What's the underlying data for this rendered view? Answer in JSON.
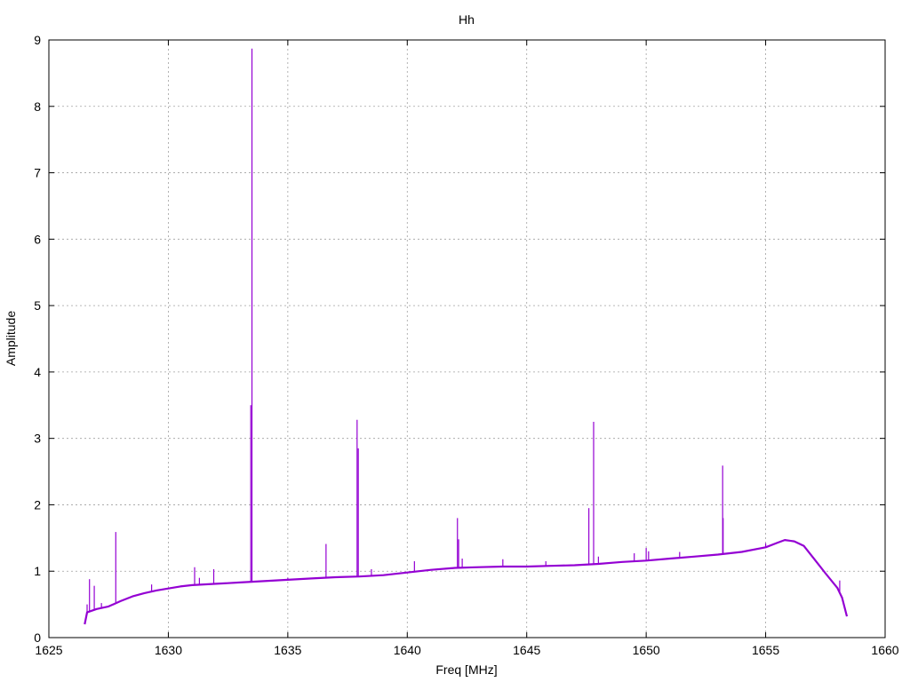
{
  "chart_data": {
    "type": "line",
    "title": "Hh",
    "xlabel": "Freq [MHz]",
    "ylabel": "Amplitude",
    "xlim": [
      1625,
      1660
    ],
    "ylim": [
      0,
      9
    ],
    "x_ticks": [
      1625,
      1630,
      1635,
      1640,
      1645,
      1650,
      1655,
      1660
    ],
    "y_ticks": [
      0,
      1,
      2,
      3,
      4,
      5,
      6,
      7,
      8,
      9
    ],
    "grid": true,
    "legend": "none",
    "series": [
      {
        "color": "#9400d3",
        "baseline": [
          [
            1626.5,
            0.2
          ],
          [
            1626.6,
            0.38
          ],
          [
            1627.0,
            0.43
          ],
          [
            1627.5,
            0.47
          ],
          [
            1628.0,
            0.55
          ],
          [
            1628.5,
            0.62
          ],
          [
            1629.0,
            0.67
          ],
          [
            1629.5,
            0.71
          ],
          [
            1630.0,
            0.74
          ],
          [
            1630.5,
            0.77
          ],
          [
            1631.0,
            0.79
          ],
          [
            1632.0,
            0.81
          ],
          [
            1633.0,
            0.83
          ],
          [
            1634.0,
            0.85
          ],
          [
            1635.0,
            0.87
          ],
          [
            1636.0,
            0.89
          ],
          [
            1637.0,
            0.91
          ],
          [
            1638.0,
            0.92
          ],
          [
            1639.0,
            0.94
          ],
          [
            1640.0,
            0.98
          ],
          [
            1640.5,
            1.0
          ],
          [
            1641.0,
            1.02
          ],
          [
            1642.0,
            1.05
          ],
          [
            1643.0,
            1.06
          ],
          [
            1644.0,
            1.07
          ],
          [
            1645.0,
            1.07
          ],
          [
            1646.0,
            1.08
          ],
          [
            1647.0,
            1.09
          ],
          [
            1648.0,
            1.11
          ],
          [
            1649.0,
            1.14
          ],
          [
            1650.0,
            1.16
          ],
          [
            1651.0,
            1.19
          ],
          [
            1652.0,
            1.22
          ],
          [
            1653.0,
            1.25
          ],
          [
            1654.0,
            1.29
          ],
          [
            1655.0,
            1.36
          ],
          [
            1655.5,
            1.43
          ],
          [
            1655.8,
            1.47
          ],
          [
            1656.2,
            1.45
          ],
          [
            1656.6,
            1.38
          ],
          [
            1657.0,
            1.2
          ],
          [
            1657.5,
            0.97
          ],
          [
            1658.0,
            0.75
          ],
          [
            1658.2,
            0.6
          ],
          [
            1658.4,
            0.32
          ]
        ],
        "peaks": [
          [
            1626.6,
            0.5
          ],
          [
            1626.7,
            0.88
          ],
          [
            1626.9,
            0.78
          ],
          [
            1627.2,
            0.52
          ],
          [
            1627.8,
            1.59
          ],
          [
            1629.3,
            0.8
          ],
          [
            1631.1,
            1.06
          ],
          [
            1631.3,
            0.9
          ],
          [
            1631.9,
            1.03
          ],
          [
            1633.45,
            3.5
          ],
          [
            1633.5,
            8.87
          ],
          [
            1635.0,
            0.9
          ],
          [
            1636.6,
            1.41
          ],
          [
            1637.9,
            3.28
          ],
          [
            1637.95,
            2.85
          ],
          [
            1638.5,
            1.03
          ],
          [
            1640.3,
            1.15
          ],
          [
            1642.1,
            1.8
          ],
          [
            1642.15,
            1.48
          ],
          [
            1642.3,
            1.19
          ],
          [
            1644.0,
            1.18
          ],
          [
            1645.8,
            1.15
          ],
          [
            1647.6,
            1.95
          ],
          [
            1647.8,
            3.25
          ],
          [
            1648.0,
            1.22
          ],
          [
            1649.5,
            1.27
          ],
          [
            1650.0,
            1.35
          ],
          [
            1650.1,
            1.3
          ],
          [
            1651.4,
            1.29
          ],
          [
            1653.2,
            2.59
          ],
          [
            1653.22,
            1.8
          ],
          [
            1655.0,
            1.42
          ],
          [
            1658.1,
            0.86
          ]
        ]
      }
    ]
  }
}
